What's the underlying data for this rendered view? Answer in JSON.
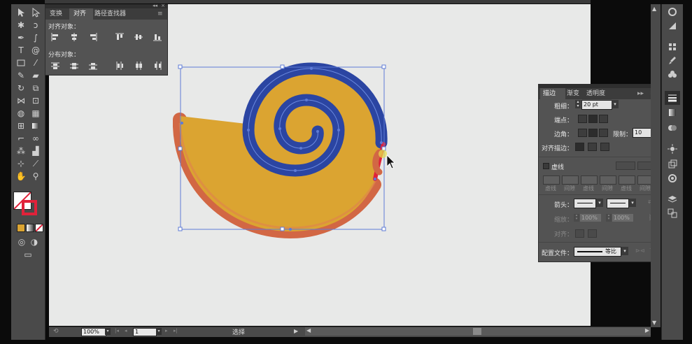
{
  "align_panel": {
    "tabs": [
      "变换",
      "对齐",
      "路径查找器"
    ],
    "align_objects_label": "对齐对象：",
    "distribute_objects_label": "分布对象："
  },
  "stroke_panel": {
    "tabs": [
      "描边",
      "渐变",
      "透明度"
    ],
    "weight_label": "粗细：",
    "weight_value": "20 pt",
    "cap_label": "端点：",
    "corner_label": "边角：",
    "limit_label": "限制：",
    "limit_value": "10",
    "align_stroke_label": "对齐描边：",
    "dashed_label": "虚线",
    "dash_labels": [
      "虚线",
      "间隙",
      "虚线",
      "间隙",
      "虚线",
      "间隙"
    ],
    "arrowhead_label": "箭头：",
    "scale_label": "缩放：",
    "scale_start": "100%",
    "scale_end": "100%",
    "align_label": "对齐：",
    "profile_label": "配置文件：",
    "profile_value": "等比"
  },
  "status_bar": {
    "zoom": "100%",
    "page": "1",
    "tool_name": "选择"
  },
  "colors": {
    "shell_fill": "#DBA431",
    "spiral_stroke": "#2B45A2",
    "shell_stroke": "#D26744",
    "selection": "#5E7BD6",
    "highlight_red": "#E0223A"
  }
}
